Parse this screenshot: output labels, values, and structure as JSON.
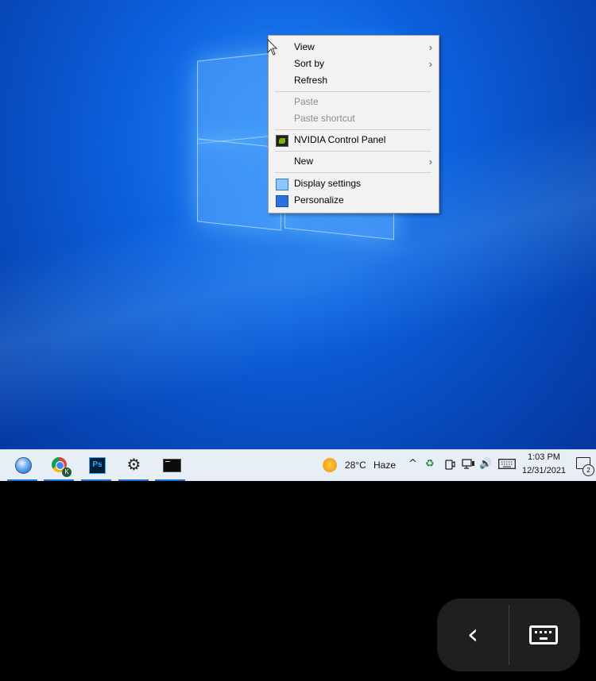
{
  "context_menu": {
    "items": [
      {
        "label": "View",
        "submenu": true,
        "enabled": true
      },
      {
        "label": "Sort by",
        "submenu": true,
        "enabled": true
      },
      {
        "label": "Refresh",
        "submenu": false,
        "enabled": true
      },
      {
        "label": "Paste",
        "submenu": false,
        "enabled": false
      },
      {
        "label": "Paste shortcut",
        "submenu": false,
        "enabled": false
      },
      {
        "label": "NVIDIA Control Panel",
        "submenu": false,
        "enabled": true,
        "icon": "nvidia-icon"
      },
      {
        "label": "New",
        "submenu": true,
        "enabled": true
      },
      {
        "label": "Display settings",
        "submenu": false,
        "enabled": true,
        "icon": "display-settings-icon"
      },
      {
        "label": "Personalize",
        "submenu": false,
        "enabled": true,
        "icon": "personalize-icon"
      }
    ],
    "submenu_glyph": "›"
  },
  "taskbar": {
    "apps": [
      {
        "name": "remote-desktop-icon"
      },
      {
        "name": "chrome-icon",
        "badge": "K"
      },
      {
        "name": "photoshop-icon",
        "label": "Ps"
      },
      {
        "name": "settings-gear-icon",
        "glyph": "⚙"
      },
      {
        "name": "terminal-icon"
      }
    ],
    "weather": {
      "temp": "28°C",
      "condition": "Haze"
    },
    "clock": {
      "time": "1:03 PM",
      "date": "12/31/2021"
    },
    "notification_count": "2",
    "tray_glyphs": {
      "chevron": "^",
      "sync": "♻",
      "volume": "🔊"
    }
  },
  "overlay": {
    "back_glyph": "‹"
  },
  "colors": {
    "accent": "#1a73d6",
    "desktop": "#0d62e0",
    "menu_bg": "#f2f2f2",
    "taskbar_bg": "#e8eef5"
  }
}
